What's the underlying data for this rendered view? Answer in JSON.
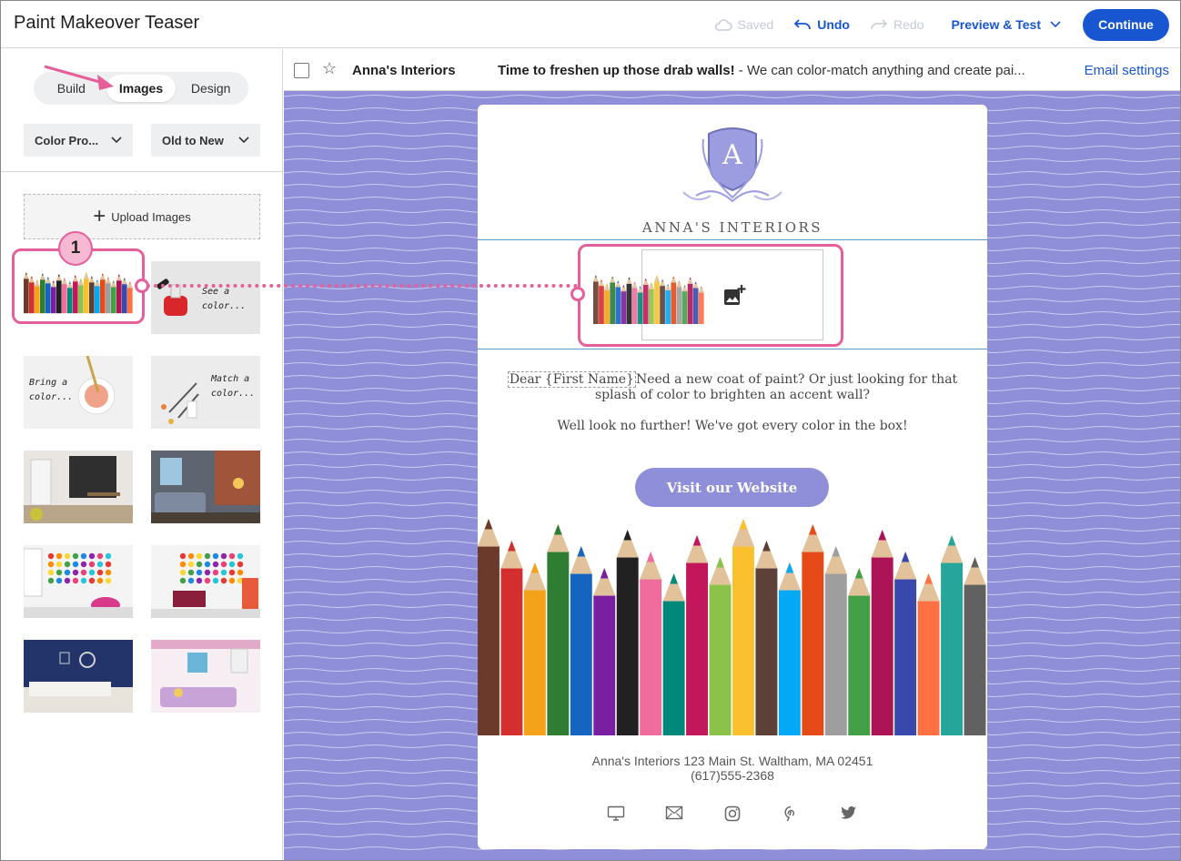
{
  "header": {
    "title": "Paint Makeover Teaser",
    "saved_label": "Saved",
    "undo_label": "Undo",
    "redo_label": "Redo",
    "preview_label": "Preview & Test",
    "continue_label": "Continue"
  },
  "sidebar": {
    "tabs": [
      {
        "label": "Build",
        "active": false
      },
      {
        "label": "Images",
        "active": true
      },
      {
        "label": "Design",
        "active": false
      }
    ],
    "filter_select": "Color Pro...",
    "sort_select": "Old to New",
    "upload_label": "Upload Images",
    "thumbnail_captions": {
      "see_color": "See a color...",
      "bring_color": "Bring a color...",
      "match_color": "Match a color..."
    }
  },
  "subject_bar": {
    "sender": "Anna's Interiors",
    "subject_bold": "Time to freshen up those drab walls!",
    "subject_rest": " - We can color-match anything and create pai...",
    "settings_link": "Email settings"
  },
  "email": {
    "logo_letter": "A",
    "logo_name": "ANNA'S INTERIORS",
    "merge_field": "Dear {First Name}",
    "paragraph1": "Need a new coat of paint? Or just looking for that splash of color to brighten an accent wall?",
    "paragraph2": "Well look no further! We've got every color in the box!",
    "cta_label": "Visit our Website",
    "footer_line1": "Anna's Interiors 123 Main St. Waltham, MA 02451",
    "footer_line2": "(617)555-2368"
  },
  "annotation": {
    "step_number": "1",
    "accent_color": "#e5609b"
  },
  "colors": {
    "brand_blue": "#1856d1",
    "canvas_lavender": "#8e8fd8"
  },
  "icons": [
    "cloud-icon",
    "undo-icon",
    "redo-icon",
    "chevron-down-icon",
    "star-icon",
    "add-image-icon",
    "desktop-icon",
    "mail-icon",
    "instagram-icon",
    "pinterest-icon",
    "twitter-icon"
  ]
}
